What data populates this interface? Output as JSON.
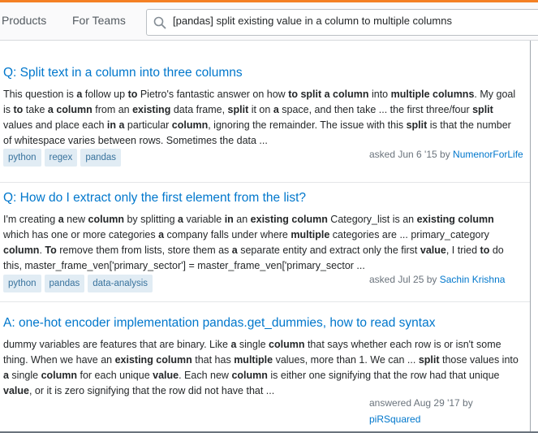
{
  "nav": {
    "products": "Products",
    "for_teams": "For Teams"
  },
  "search": {
    "value": "[pandas] split existing value in a column to multiple columns"
  },
  "results": [
    {
      "title": "Q: Split text in a column into three columns",
      "excerpt": [
        {
          "t": "This question is "
        },
        {
          "t": "a",
          "b": true
        },
        {
          "t": " follow up "
        },
        {
          "t": "to",
          "b": true
        },
        {
          "t": " Pietro's fantastic answer on how "
        },
        {
          "t": "to split a column",
          "b": true
        },
        {
          "t": " into "
        },
        {
          "t": "multiple columns",
          "b": true
        },
        {
          "t": ". My goal is "
        },
        {
          "t": "to",
          "b": true
        },
        {
          "t": " take "
        },
        {
          "t": "a column",
          "b": true
        },
        {
          "t": " from an "
        },
        {
          "t": "existing",
          "b": true
        },
        {
          "t": " data frame, "
        },
        {
          "t": "split",
          "b": true
        },
        {
          "t": " it on "
        },
        {
          "t": "a",
          "b": true
        },
        {
          "t": " space, and then take ... the first three/four "
        },
        {
          "t": "split",
          "b": true
        },
        {
          "t": " values and place each "
        },
        {
          "t": "in a",
          "b": true
        },
        {
          "t": " particular "
        },
        {
          "t": "column",
          "b": true
        },
        {
          "t": ", ignoring the remainder. The issue with this "
        },
        {
          "t": "split",
          "b": true
        },
        {
          "t": " is that the number of whitespace varies between rows. Sometimes the data ..."
        }
      ],
      "tags": [
        "python",
        "regex",
        "pandas"
      ],
      "meta_text": "asked Jun 6 '15 by ",
      "user": "NumenorForLife"
    },
    {
      "title": "Q: How do I extract only the first element from the list?",
      "excerpt": [
        {
          "t": "I'm creating "
        },
        {
          "t": "a",
          "b": true
        },
        {
          "t": " new "
        },
        {
          "t": "column",
          "b": true
        },
        {
          "t": " by splitting "
        },
        {
          "t": "a",
          "b": true
        },
        {
          "t": " variable "
        },
        {
          "t": "in",
          "b": true
        },
        {
          "t": " an "
        },
        {
          "t": "existing column",
          "b": true
        },
        {
          "t": " Category_list is an "
        },
        {
          "t": "existing column",
          "b": true
        },
        {
          "t": " which has one or more categories "
        },
        {
          "t": "a",
          "b": true
        },
        {
          "t": " company falls under where "
        },
        {
          "t": "multiple",
          "b": true
        },
        {
          "t": " categories are ... primary_category "
        },
        {
          "t": "column",
          "b": true
        },
        {
          "t": ". "
        },
        {
          "t": "To",
          "b": true
        },
        {
          "t": " remove them from lists, store them as "
        },
        {
          "t": "a",
          "b": true
        },
        {
          "t": " separate entity and extract only the first "
        },
        {
          "t": "value",
          "b": true
        },
        {
          "t": ", I tried "
        },
        {
          "t": "to",
          "b": true
        },
        {
          "t": " do this, master_frame_ven['primary_sector'] = master_frame_ven['primary_sector ..."
        }
      ],
      "tags": [
        "python",
        "pandas",
        "data-analysis"
      ],
      "meta_text": "asked Jul 25 by ",
      "user": "Sachin Krishna"
    },
    {
      "title": "A: one-hot encoder implementation pandas.get_dummies, how to read syntax",
      "excerpt": [
        {
          "t": "dummy variables are features that are binary. Like "
        },
        {
          "t": "a",
          "b": true
        },
        {
          "t": " single "
        },
        {
          "t": "column",
          "b": true
        },
        {
          "t": " that says whether each row is or isn't some thing. When we have an "
        },
        {
          "t": "existing column",
          "b": true
        },
        {
          "t": " that has "
        },
        {
          "t": "multiple",
          "b": true
        },
        {
          "t": " values, more than 1. We can ... "
        },
        {
          "t": "split",
          "b": true
        },
        {
          "t": " those values into "
        },
        {
          "t": "a",
          "b": true
        },
        {
          "t": " single "
        },
        {
          "t": "column",
          "b": true
        },
        {
          "t": " for each unique "
        },
        {
          "t": "value",
          "b": true
        },
        {
          "t": ". Each new "
        },
        {
          "t": "column",
          "b": true
        },
        {
          "t": " is either one signifying that the row had that unique "
        },
        {
          "t": "value",
          "b": true
        },
        {
          "t": ", or it is zero signifying that the row did not have that ..."
        }
      ],
      "tags": [],
      "meta_text": "answered Aug 29 '17 by",
      "user": "piRSquared"
    }
  ]
}
